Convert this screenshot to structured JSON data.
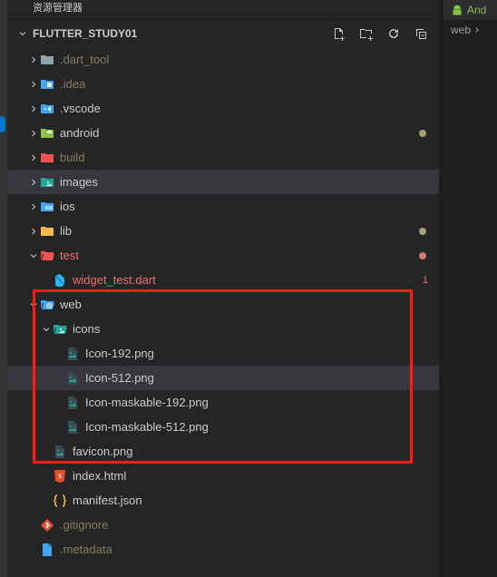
{
  "topbar": {
    "title": "资源管理器"
  },
  "project": {
    "name": "FLUTTER_STUDY01"
  },
  "editor": {
    "tab_prefix": "And",
    "breadcrumb": "web"
  },
  "tree": {
    "items": [
      {
        "type": "folder",
        "label": ".dart_tool",
        "expanded": false,
        "depth": 1,
        "iconColor": "#90a4ae",
        "labelClass": "muted"
      },
      {
        "type": "folder",
        "label": ".idea",
        "expanded": false,
        "depth": 1,
        "iconColor": "#42a5f5",
        "iconType": "idea",
        "labelClass": "muted"
      },
      {
        "type": "folder",
        "label": ".vscode",
        "expanded": false,
        "depth": 1,
        "iconColor": "#42a5f5",
        "iconType": "vscode"
      },
      {
        "type": "folder",
        "label": "android",
        "expanded": false,
        "depth": 1,
        "iconColor": "#8bc34a",
        "iconType": "android",
        "modified": true
      },
      {
        "type": "folder",
        "label": "build",
        "expanded": false,
        "depth": 1,
        "iconColor": "#ef5350",
        "labelClass": "muted"
      },
      {
        "type": "folder",
        "label": "images",
        "expanded": false,
        "depth": 1,
        "iconColor": "#26a69a",
        "iconType": "images",
        "selected": true
      },
      {
        "type": "folder",
        "label": "ios",
        "expanded": false,
        "depth": 1,
        "iconColor": "#42a5f5",
        "iconType": "ios"
      },
      {
        "type": "folder",
        "label": "lib",
        "expanded": false,
        "depth": 1,
        "iconColor": "#ffb74d",
        "modified": true
      },
      {
        "type": "folder",
        "label": "test",
        "expanded": true,
        "depth": 1,
        "iconColor": "#ef5350",
        "labelClass": "red",
        "error": true
      },
      {
        "type": "file",
        "label": "widget_test.dart",
        "depth": 2,
        "iconColor": "#29b6f6",
        "iconType": "dart",
        "labelClass": "red",
        "count": "1"
      },
      {
        "type": "folder",
        "label": "web",
        "expanded": true,
        "depth": 1,
        "iconColor": "#42a5f5",
        "iconType": "web"
      },
      {
        "type": "folder",
        "label": "icons",
        "expanded": true,
        "depth": 2,
        "iconColor": "#26a69a",
        "iconType": "images"
      },
      {
        "type": "file",
        "label": "Icon-192.png",
        "depth": 3,
        "iconColor": "#26a69a",
        "iconType": "image"
      },
      {
        "type": "file",
        "label": "Icon-512.png",
        "depth": 3,
        "iconColor": "#26a69a",
        "iconType": "image",
        "selected": true
      },
      {
        "type": "file",
        "label": "Icon-maskable-192.png",
        "depth": 3,
        "iconColor": "#26a69a",
        "iconType": "image"
      },
      {
        "type": "file",
        "label": "Icon-maskable-512.png",
        "depth": 3,
        "iconColor": "#26a69a",
        "iconType": "image"
      },
      {
        "type": "file",
        "label": "favicon.png",
        "depth": 2,
        "iconColor": "#26a69a",
        "iconType": "image"
      },
      {
        "type": "file",
        "label": "index.html",
        "depth": 2,
        "iconColor": "#e44d26",
        "iconType": "html"
      },
      {
        "type": "file",
        "label": "manifest.json",
        "depth": 2,
        "iconColor": "#ffca28",
        "iconType": "json"
      },
      {
        "type": "file",
        "label": ".gitignore",
        "depth": 1,
        "iconColor": "#e84e31",
        "iconType": "git",
        "labelClass": "muted"
      },
      {
        "type": "file",
        "label": ".metadata",
        "depth": 1,
        "iconColor": "#42a5f5",
        "iconType": "file",
        "labelClass": "muted"
      }
    ]
  }
}
